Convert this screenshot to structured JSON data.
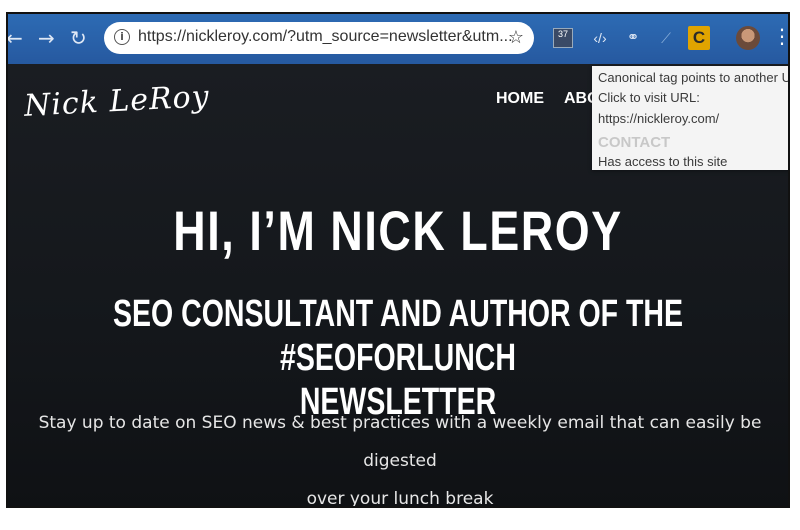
{
  "browser": {
    "address_url": "https://nickleroy.com/?utm_source=newsletter&utm...",
    "extension_badge": "37",
    "extension_letter": "C"
  },
  "tooltip": {
    "line1": "Canonical tag points to another URL",
    "line2": "Click to visit URL:",
    "line3": "https://nickleroy.com/",
    "line4": "CONTACT",
    "line5": "Has access to this site"
  },
  "site": {
    "logo": "Nick LeRoy",
    "nav": {
      "home": "HOME",
      "about": "ABO"
    },
    "hero_title": "HI, I’M NICK LEROY",
    "hero_subtitle_line1": "SEO CONSULTANT AND AUTHOR OF THE #SEOFORLUNCH",
    "hero_subtitle_line2": "NEWSLETTER",
    "hero_desc_line1": "Stay up to date on SEO news & best practices with a weekly email that can easily be digested",
    "hero_desc_line2": "over your lunch break"
  }
}
